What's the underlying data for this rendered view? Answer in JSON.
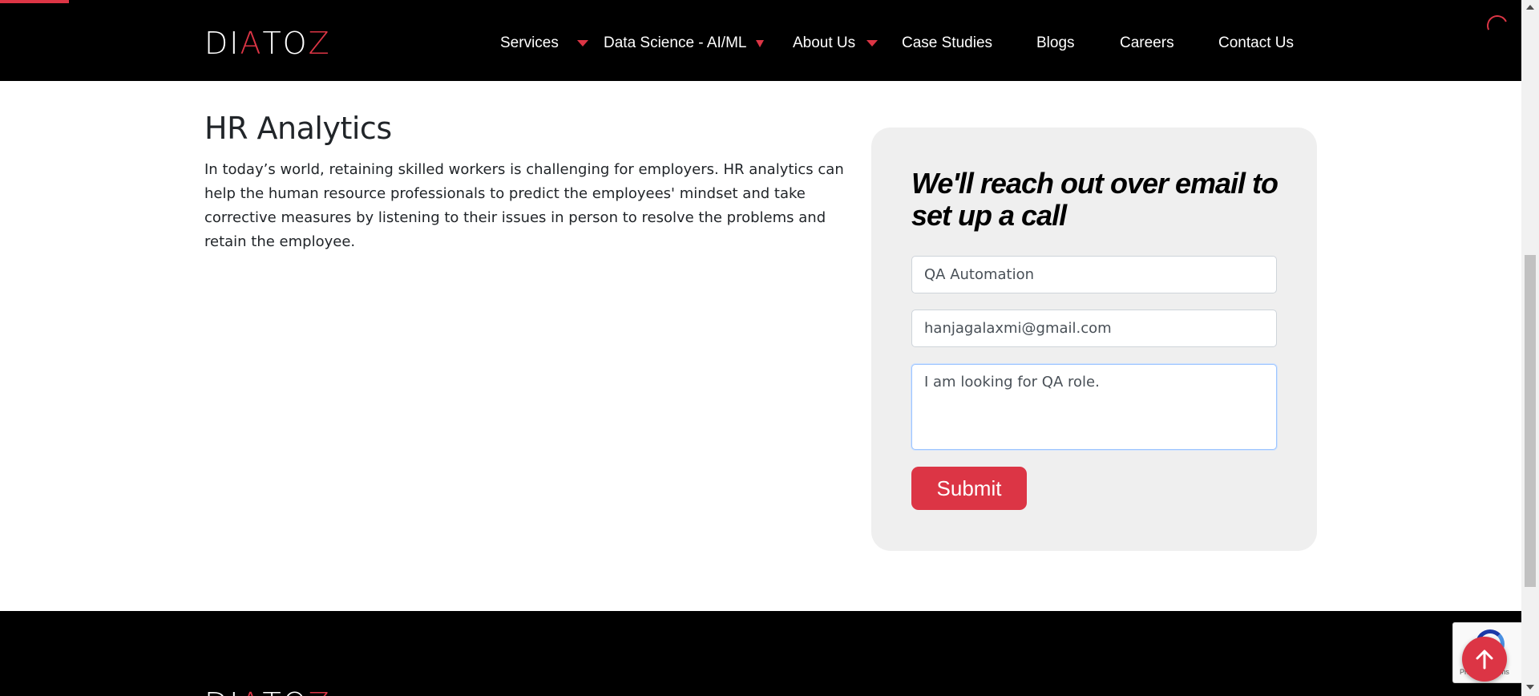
{
  "header": {
    "logo": {
      "l1": "DI",
      "l2": "A",
      "l3": "TO",
      "l4": "Z"
    },
    "nav": [
      {
        "label": "Services",
        "has_dropdown": true
      },
      {
        "label": "Data Science - AI/ML",
        "has_dropdown": true
      },
      {
        "label": "About Us",
        "has_dropdown": true
      },
      {
        "label": "Case Studies",
        "has_dropdown": false
      },
      {
        "label": "Blogs",
        "has_dropdown": false
      },
      {
        "label": "Careers",
        "has_dropdown": false
      },
      {
        "label": "Contact Us",
        "has_dropdown": false
      }
    ]
  },
  "main": {
    "title": "HR Analytics",
    "description": "In today’s world, retaining skilled workers is challenging for employers. HR analytics can help the human resource professionals to predict the employees' mindset and take corrective measures by listening to their issues in person to resolve the problems and retain the employee."
  },
  "form": {
    "title": "We'll reach out over email to set up a call",
    "name_value": "QA Automation",
    "email_value": "hanjagalaxmi@gmail.com",
    "message_value": "I am looking for QA role.",
    "submit_label": "Submit"
  },
  "recaptcha": {
    "text": "Privacy - Terms"
  },
  "colors": {
    "accent": "#dc3545",
    "header_bg": "#000000",
    "card_bg": "#efefef"
  },
  "icons": {
    "back_to_top": "arrow-up-icon",
    "loading": "spinner-icon"
  }
}
